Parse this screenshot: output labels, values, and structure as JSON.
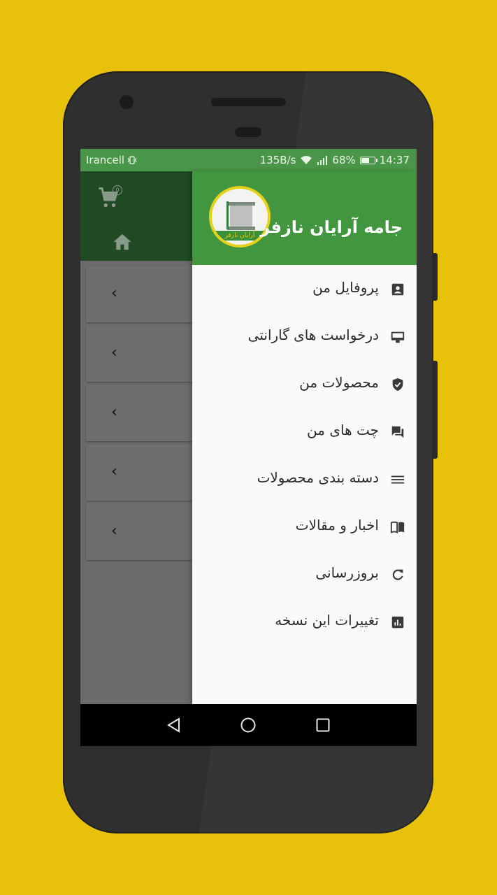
{
  "status_bar": {
    "carrier": "Irancell",
    "speed": "135B/s",
    "battery": "68%",
    "battery_level": 0.68,
    "time": "14:37"
  },
  "background_app": {
    "cart_badge": "0",
    "card_count": 5
  },
  "drawer": {
    "title": "جامه آرایان نازفر",
    "logo_text": "آرایان نازفر",
    "items": [
      {
        "label": "پروفایل من",
        "icon": "account-box-icon"
      },
      {
        "label": "درخواست های گارانتی",
        "icon": "warranty-icon"
      },
      {
        "label": "محصولات من",
        "icon": "verified-shield-icon"
      },
      {
        "label": "چت های من",
        "icon": "chat-icon"
      },
      {
        "label": "دسته بندی محصولات",
        "icon": "list-icon"
      },
      {
        "label": "اخبار و مقالات",
        "icon": "book-icon"
      },
      {
        "label": "بروزرسانی",
        "icon": "refresh-icon"
      },
      {
        "label": "تغییرات این نسخه",
        "icon": "bar-chart-icon"
      }
    ]
  },
  "colors": {
    "accent_green": "#42963f",
    "status_green": "#4a9648",
    "background_yellow": "#e8c20a"
  }
}
